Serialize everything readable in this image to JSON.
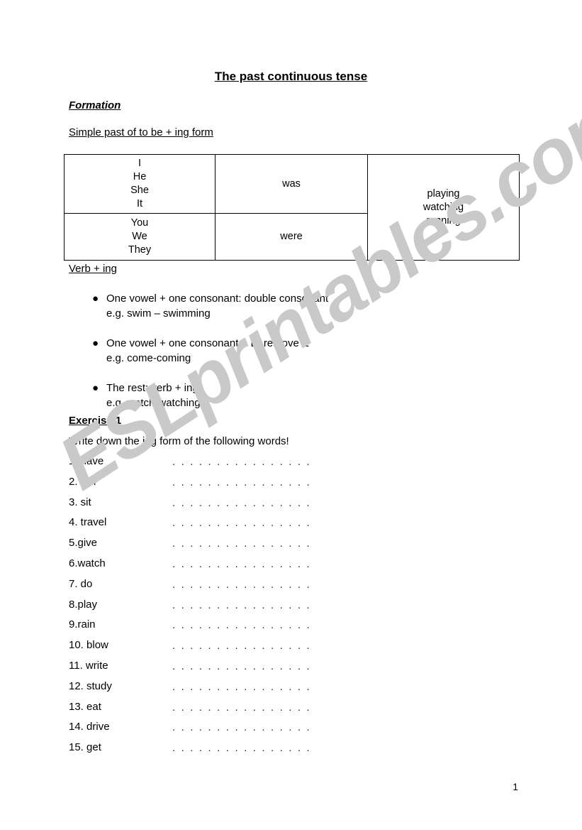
{
  "document": {
    "title": "The past continuous tense",
    "page_number": "1",
    "watermark": "ESLprintables.com",
    "watermark_color": "#c9c9c9"
  },
  "formation": {
    "heading": "Formation",
    "subheading": "Simple past of to be + ing form",
    "table": {
      "rows": [
        {
          "pronouns": [
            "I",
            "He",
            "She",
            "It"
          ],
          "be": "was"
        },
        {
          "pronouns": [
            "You",
            "We",
            "They"
          ],
          "be": "were"
        }
      ],
      "ing_examples": [
        "playing",
        "watching",
        "running"
      ]
    }
  },
  "verb_ing": {
    "subheading": "Verb + ing",
    "rules": [
      {
        "rule": "One vowel + one consonant: double consonant",
        "example": "e.g. swim – swimming"
      },
      {
        "rule": "One vowel + one consonant + E: remove E",
        "example": "e.g. come-coming"
      },
      {
        "rule": "The rest: verb + ing",
        "example": "e.g. watch-watching"
      }
    ],
    "bullet_glyph": "●"
  },
  "exercise": {
    "heading": "Exercise 1",
    "instruction": "Write down the ing form of the following words!",
    "answer_dots": ". . . . . . . . . . . . . . . . . . . . . . . . . . . . . . . . . . . .",
    "items": [
      "1. have",
      "2. run",
      "3. sit",
      "4. travel",
      "5.give",
      "6.watch",
      "7. do",
      "8.play",
      "9.rain",
      "10. blow",
      "11. write",
      "12. study",
      "13. eat",
      "14. drive",
      "15. get"
    ]
  }
}
